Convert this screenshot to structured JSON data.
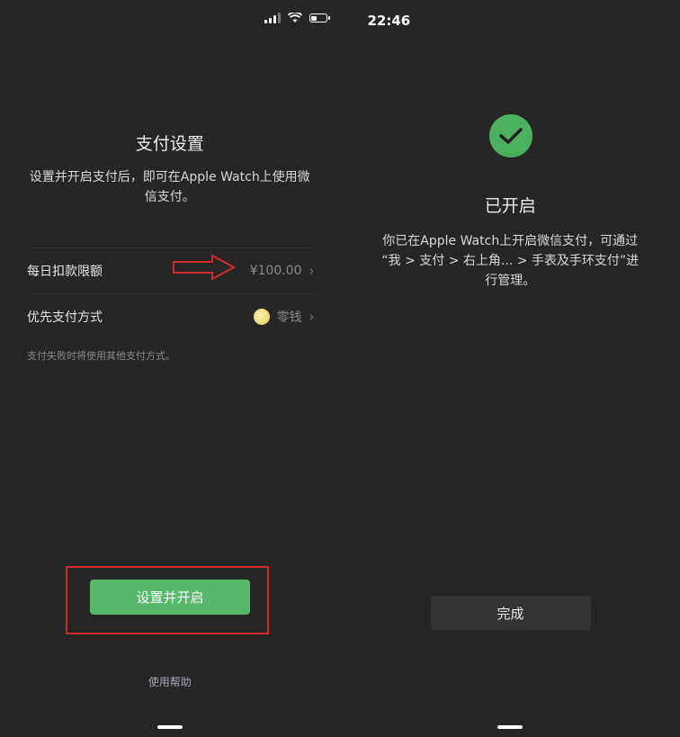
{
  "left": {
    "title": "支付设置",
    "description": "设置并开启支付后，即可在Apple Watch上使用微信支付。",
    "daily_limit": {
      "label": "每日扣款限额",
      "value": "¥100.00"
    },
    "payment_method": {
      "label": "优先支付方式",
      "value": "零钱"
    },
    "note": "支付失败时将使用其他支付方式。",
    "primary_button": "设置并开启",
    "help_link": "使用帮助"
  },
  "right": {
    "time": "22:46",
    "title": "已开启",
    "description_line1": "你已在Apple Watch上开启微信支付，可通过",
    "description_line2": "“我 > 支付 > 右上角... > 手表及手环支付”进",
    "description_line3": "行管理。",
    "done_button": "完成"
  },
  "colors": {
    "background": "#262626",
    "accent_green": "#55b86a",
    "highlight_red": "#d22a2a"
  },
  "icons": [
    "signal-icon",
    "wifi-icon",
    "battery-icon",
    "arrow-annotation-icon",
    "coin-icon",
    "chevron-right-icon",
    "check-icon"
  ]
}
